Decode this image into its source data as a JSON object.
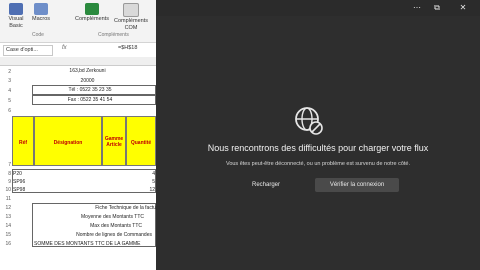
{
  "ribbon": {
    "buttons": [
      "Visual\nBasic",
      "Macros",
      "Compléments",
      "Compléments\nCOM"
    ],
    "groups": [
      "Code",
      "Compléments"
    ]
  },
  "formula_bar": {
    "name_box": "Case d'opti...",
    "fx": "fx",
    "formula": "=$H$18"
  },
  "sheet": {
    "row_numbers": [
      "2",
      "3",
      "4",
      "5",
      "6",
      "7",
      "8",
      "9",
      "10",
      "11",
      "12",
      "13",
      "14",
      "15",
      "16"
    ],
    "header_lines": [
      "163,bd Zerkouni",
      "20000",
      "Tél : 0522 35 23 35",
      "Fax : 0522 35 41 54"
    ],
    "table_headers": [
      "Réf",
      "Désignation",
      "Gamme Article",
      "Quantité"
    ],
    "rows": [
      {
        "ref": "P20",
        "qty": "4"
      },
      {
        "ref": "SP96",
        "qty": "5"
      },
      {
        "ref": "SP98",
        "qty": "12"
      }
    ],
    "summary": [
      "Fiche Technique de la factu",
      "Moyenne des Montants TTC",
      "Max des Montants TTC",
      "Nombre de lignes de Commandes",
      "SOMME DES MONTANTS TTC DE LA GAMME"
    ]
  },
  "overlay": {
    "title": "Nous rencontrons des difficultés pour charger votre flux",
    "description": "Vous êtes peut-être déconnecté, ou un problème est survenu de notre côté.",
    "reload_label": "Recharger",
    "connect_label": "Vérifier la connexion",
    "colors": {
      "panel": "#2e2e2e",
      "yellow": "#ffff00"
    }
  }
}
